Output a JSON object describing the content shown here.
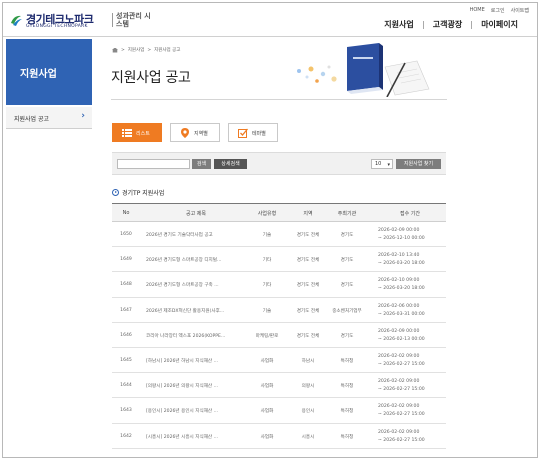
{
  "header": {
    "logo_main": "경기테크노파크",
    "logo_sub": "GYEONGGI TECHNOPARK",
    "system_name": "성과관리 시스템",
    "util_links": [
      "HOME",
      "로그인",
      "사이트맵"
    ],
    "nav": [
      "지원사업",
      "고객광장",
      "마이페이지"
    ]
  },
  "sidebar": {
    "title": "지원사업",
    "items": [
      {
        "label": "지원사업 공고"
      }
    ]
  },
  "breadcrumb": [
    "지원사업",
    "지원사업 공고"
  ],
  "page_title": "지원사업 공고",
  "tabs": [
    {
      "label": "리스트",
      "icon": "list-icon",
      "active": true
    },
    {
      "label": "지역별",
      "icon": "location-pin-icon",
      "active": false
    },
    {
      "label": "테마별",
      "icon": "check-box-icon",
      "active": false
    }
  ],
  "search": {
    "input_value": "",
    "search_label": "검색",
    "detail_label": "상세검색",
    "page_size": "10",
    "view_label": "지원사업 찾기"
  },
  "section_title": "경기TP 지원사업",
  "table": {
    "columns": [
      "No",
      "공고 제목",
      "사업유형",
      "지역",
      "주최기관",
      "접수 기간"
    ],
    "rows": [
      {
        "no": "1650",
        "title": "2026년 경기도 기술닥터사업 공고",
        "type": "기술",
        "area": "경기도 전체",
        "org": "경기도",
        "start": "2026-02-09 00:00",
        "end": "~ 2026-12-10 00:00"
      },
      {
        "no": "1649",
        "title": "2026년 경기도형 스마트공장 디지털...",
        "type": "기타",
        "area": "경기도 전체",
        "org": "경기도",
        "start": "2026-02-10 13:40",
        "end": "~ 2026-03-20 18:00"
      },
      {
        "no": "1648",
        "title": "2026년 경기도형 스마트공장 구축 ...",
        "type": "기타",
        "area": "경기도 전체",
        "org": "경기도",
        "start": "2026-02-10 09:00",
        "end": "~ 2026-03-20 18:00"
      },
      {
        "no": "1647",
        "title": "2026년 제조DX혁신단 활용지원(사후...",
        "type": "기술",
        "area": "경기도 전체",
        "org": "중소벤처기업부",
        "start": "2026-02-06 00:00",
        "end": "~ 2026-03-31 00:00"
      },
      {
        "no": "1646",
        "title": "코리아 나라장터 엑스포 2026(KOPPE...",
        "type": "마케팅/판로",
        "area": "경기도 전체",
        "org": "경기도",
        "start": "2026-02-09 00:00",
        "end": "~ 2026-02-13 00:00"
      },
      {
        "no": "1645",
        "title": "[하남시] 2026년 하남시 지식재산 ...",
        "type": "사업화",
        "area": "하남시",
        "org": "특허청",
        "start": "2026-02-02 09:00",
        "end": "~ 2026-02-27 15:00"
      },
      {
        "no": "1644",
        "title": "[의왕시] 2026년 의왕시 지식재산 ...",
        "type": "사업화",
        "area": "의왕시",
        "org": "특허청",
        "start": "2026-02-02 09:00",
        "end": "~ 2026-02-27 15:00"
      },
      {
        "no": "1643",
        "title": "[용인시] 2026년 용인시 지식재산 ...",
        "type": "사업화",
        "area": "용인시",
        "org": "특허청",
        "start": "2026-02-02 09:00",
        "end": "~ 2026-02-27 15:00"
      },
      {
        "no": "1642",
        "title": "[시흥시] 2026년 시흥시 지식재산 ...",
        "type": "사업화",
        "area": "시흥시",
        "org": "특허청",
        "start": "2026-02-02 09:00",
        "end": "~ 2026-02-27 15:00"
      }
    ]
  },
  "colors": {
    "brand_blue": "#2f63b4",
    "active_tab": "#ef7b22",
    "logo_navy": "#1d2a6e"
  }
}
